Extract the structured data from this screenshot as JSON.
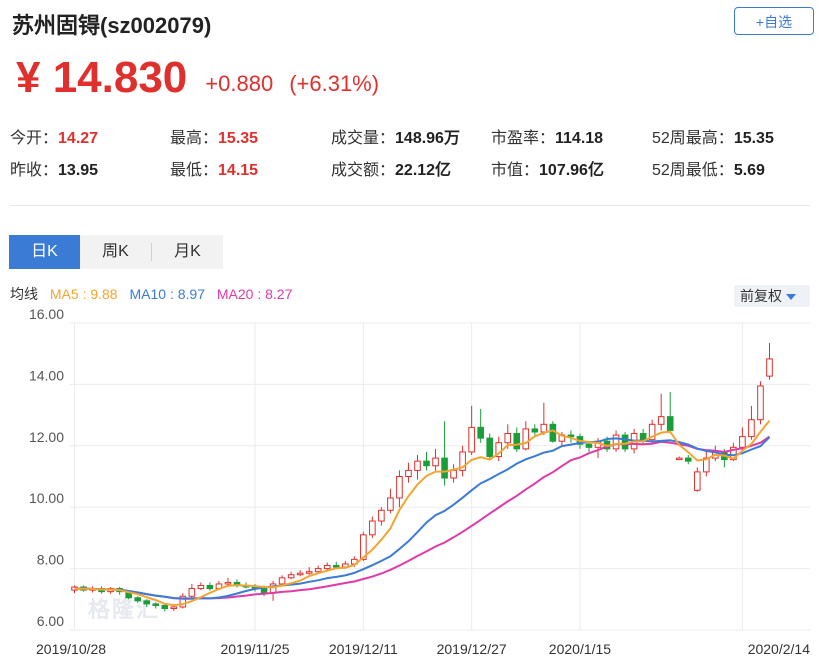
{
  "header": {
    "title": "苏州固锝(sz002079)",
    "add_label": "+自选",
    "price": "¥ 14.830",
    "change": "+0.880",
    "change_pct": "(+6.31%)"
  },
  "stats": [
    {
      "label": "今开：",
      "value": "14.27",
      "color": "red"
    },
    {
      "label": "最高：",
      "value": "15.35",
      "color": "red"
    },
    {
      "label": "成交量：",
      "value": "148.96万",
      "color": "dark"
    },
    {
      "label": "市盈率：",
      "value": "114.18",
      "color": "dark"
    },
    {
      "label": "52周最高：",
      "value": "15.35",
      "color": "dark"
    },
    {
      "label": "昨收：",
      "value": "13.95",
      "color": "dark"
    },
    {
      "label": "最低：",
      "value": "14.15",
      "color": "red"
    },
    {
      "label": "成交额：",
      "value": "22.12亿",
      "color": "dark"
    },
    {
      "label": "市值：",
      "value": "107.96亿",
      "color": "dark"
    },
    {
      "label": "52周最低：",
      "value": "5.69",
      "color": "dark"
    }
  ],
  "tabs": [
    "日K",
    "周K",
    "月K"
  ],
  "active_tab": 0,
  "legend": {
    "label": "均线",
    "ma5": "MA5 : 9.88",
    "ma10": "MA10 : 8.97",
    "ma20": "MA20 : 8.27"
  },
  "adjust_label": "前复权",
  "watermark": "格隆汇",
  "colors": {
    "up": "#e0302d",
    "down": "#1a9e3a",
    "ma5": "#f4a431",
    "ma10": "#3a7bd5",
    "ma20": "#e03aa8",
    "accent": "#3a7bd5"
  },
  "chart_data": {
    "type": "candlestick",
    "ylim": [
      6,
      16
    ],
    "yticks": [
      "16.00",
      "14.00",
      "12.00",
      "10.00",
      "8.00",
      "6.00"
    ],
    "xticks": [
      {
        "index": 0,
        "label": "2019/10/28"
      },
      {
        "index": 20,
        "label": "2019/11/25"
      },
      {
        "index": 32,
        "label": "2019/12/11"
      },
      {
        "index": 44,
        "label": "2019/12/27"
      },
      {
        "index": 56,
        "label": "2020/1/15"
      },
      {
        "index": 74,
        "label": "2020/2/14"
      }
    ],
    "candles": [
      [
        7.3,
        7.4,
        7.45,
        7.2
      ],
      [
        7.4,
        7.3,
        7.45,
        7.25
      ],
      [
        7.3,
        7.35,
        7.42,
        7.22
      ],
      [
        7.35,
        7.25,
        7.42,
        7.18
      ],
      [
        7.25,
        7.35,
        7.4,
        7.18
      ],
      [
        7.35,
        7.25,
        7.4,
        7.15
      ],
      [
        7.25,
        7.05,
        7.3,
        7.0
      ],
      [
        7.05,
        6.95,
        7.1,
        6.88
      ],
      [
        6.95,
        6.85,
        7.0,
        6.75
      ],
      [
        6.85,
        6.8,
        6.9,
        6.7
      ],
      [
        6.8,
        6.7,
        6.85,
        6.6
      ],
      [
        6.7,
        6.75,
        6.82,
        6.62
      ],
      [
        6.75,
        7.1,
        7.2,
        6.7
      ],
      [
        7.1,
        7.35,
        7.5,
        7.05
      ],
      [
        7.35,
        7.45,
        7.55,
        7.3
      ],
      [
        7.45,
        7.35,
        7.55,
        7.28
      ],
      [
        7.35,
        7.5,
        7.6,
        7.3
      ],
      [
        7.5,
        7.55,
        7.7,
        7.4
      ],
      [
        7.55,
        7.45,
        7.65,
        7.38
      ],
      [
        7.45,
        7.4,
        7.55,
        7.35
      ],
      [
        7.4,
        7.35,
        7.5,
        7.25
      ],
      [
        7.35,
        7.2,
        7.45,
        7.1
      ],
      [
        7.2,
        7.5,
        7.6,
        6.95
      ],
      [
        7.5,
        7.7,
        7.78,
        7.45
      ],
      [
        7.7,
        7.8,
        7.9,
        7.65
      ],
      [
        7.8,
        7.85,
        7.95,
        7.75
      ],
      [
        7.85,
        7.9,
        8.05,
        7.8
      ],
      [
        7.9,
        8.0,
        8.1,
        7.85
      ],
      [
        8.0,
        8.1,
        8.2,
        7.95
      ],
      [
        8.1,
        8.05,
        8.22,
        8.0
      ],
      [
        8.05,
        8.15,
        8.25,
        8.0
      ],
      [
        8.15,
        8.3,
        8.4,
        8.05
      ],
      [
        8.3,
        9.1,
        9.2,
        8.25
      ],
      [
        9.1,
        9.55,
        9.7,
        9.0
      ],
      [
        9.55,
        9.9,
        10.0,
        9.4
      ],
      [
        9.9,
        10.3,
        10.6,
        9.8
      ],
      [
        10.3,
        11.0,
        11.2,
        10.0
      ],
      [
        11.0,
        11.2,
        11.45,
        10.8
      ],
      [
        11.2,
        11.5,
        11.7,
        10.9
      ],
      [
        11.5,
        11.35,
        11.8,
        11.2
      ],
      [
        11.35,
        11.6,
        11.9,
        11.2
      ],
      [
        11.6,
        10.95,
        12.8,
        10.7
      ],
      [
        10.95,
        11.2,
        11.4,
        10.8
      ],
      [
        11.2,
        11.8,
        12.0,
        11.0
      ],
      [
        11.8,
        12.6,
        13.3,
        11.7
      ],
      [
        12.6,
        12.25,
        13.2,
        12.1
      ],
      [
        12.25,
        11.65,
        12.4,
        11.55
      ],
      [
        11.65,
        12.1,
        12.3,
        11.5
      ],
      [
        12.1,
        12.4,
        12.7,
        11.9
      ],
      [
        12.4,
        11.9,
        12.6,
        11.8
      ],
      [
        11.9,
        12.55,
        12.8,
        11.85
      ],
      [
        12.55,
        12.45,
        12.7,
        12.3
      ],
      [
        12.45,
        12.7,
        13.4,
        12.35
      ],
      [
        12.7,
        12.15,
        12.8,
        12.1
      ],
      [
        12.15,
        12.35,
        12.45,
        12.0
      ],
      [
        12.35,
        12.3,
        12.5,
        12.1
      ],
      [
        12.3,
        12.05,
        12.4,
        11.9
      ],
      [
        12.05,
        11.95,
        12.15,
        11.8
      ],
      [
        11.95,
        12.15,
        12.25,
        11.6
      ],
      [
        12.15,
        11.9,
        12.3,
        11.8
      ],
      [
        11.9,
        12.35,
        12.5,
        11.8
      ],
      [
        12.35,
        11.9,
        12.45,
        11.8
      ],
      [
        11.9,
        12.4,
        12.55,
        11.75
      ],
      [
        12.4,
        12.2,
        12.55,
        12.05
      ],
      [
        12.2,
        12.7,
        12.85,
        12.1
      ],
      [
        12.7,
        12.95,
        13.7,
        12.5
      ],
      [
        12.95,
        12.5,
        13.75,
        12.4
      ],
      [
        11.6,
        11.6,
        11.65,
        11.55
      ],
      [
        11.6,
        11.5,
        11.7,
        11.4
      ],
      [
        10.55,
        11.15,
        11.3,
        10.5
      ],
      [
        11.15,
        11.6,
        11.85,
        11.0
      ],
      [
        11.6,
        11.8,
        12.0,
        11.5
      ],
      [
        11.8,
        11.55,
        11.9,
        11.3
      ],
      [
        11.55,
        11.95,
        12.1,
        11.5
      ],
      [
        11.95,
        12.3,
        12.6,
        11.85
      ],
      [
        12.3,
        12.85,
        13.3,
        12.2
      ],
      [
        12.85,
        13.95,
        14.1,
        12.7
      ],
      [
        14.27,
        14.83,
        15.35,
        14.15
      ]
    ],
    "ma5": [
      7.34,
      7.35,
      7.34,
      7.32,
      7.32,
      7.3,
      7.23,
      7.17,
      7.07,
      6.98,
      6.85,
      6.81,
      6.84,
      6.94,
      7.07,
      7.21,
      7.34,
      7.44,
      7.46,
      7.45,
      7.43,
      7.4,
      7.39,
      7.45,
      7.52,
      7.61,
      7.76,
      7.85,
      7.93,
      8.01,
      8.03,
      8.12,
      8.36,
      8.62,
      8.94,
      9.31,
      9.91,
      10.36,
      10.74,
      11.02,
      11.16,
      11.16,
      11.22,
      11.3,
      11.54,
      11.63,
      11.55,
      11.75,
      12.02,
      12.04,
      12.09,
      12.31,
      12.42,
      12.5,
      12.33,
      12.26,
      12.16,
      12.12,
      12.09,
      12.0,
      12.06,
      12.07,
      12.14,
      12.15,
      12.3,
      12.43,
      12.46,
      12.03,
      11.79,
      11.52,
      11.56,
      11.71,
      11.68,
      11.58,
      11.84,
      12.06,
      12.46,
      12.82
    ],
    "ma10": [
      7.34,
      7.35,
      7.34,
      7.33,
      7.32,
      7.31,
      7.27,
      7.22,
      7.17,
      7.12,
      7.08,
      7.04,
      7.03,
      7.03,
      7.04,
      7.03,
      7.06,
      7.11,
      7.19,
      7.27,
      7.34,
      7.38,
      7.42,
      7.45,
      7.48,
      7.51,
      7.57,
      7.62,
      7.69,
      7.73,
      7.78,
      7.86,
      7.98,
      8.11,
      8.25,
      8.4,
      8.64,
      8.89,
      9.19,
      9.5,
      9.74,
      9.88,
      10.08,
      10.31,
      10.55,
      10.78,
      10.92,
      11.08,
      11.23,
      11.42,
      11.56,
      11.66,
      11.78,
      11.84,
      11.99,
      12.04,
      12.09,
      12.12,
      12.13,
      12.22,
      12.24,
      12.21,
      12.17,
      12.17,
      12.14,
      12.16,
      12.18,
      12.12,
      12.04,
      11.91,
      11.83,
      11.79,
      11.71,
      11.69,
      11.76,
      11.88,
      11.99,
      12.28
    ],
    "ma20": [
      7.34,
      7.35,
      7.34,
      7.33,
      7.32,
      7.31,
      7.27,
      7.22,
      7.17,
      7.12,
      7.08,
      7.04,
      7.02,
      7.02,
      7.03,
      7.03,
      7.04,
      7.06,
      7.09,
      7.12,
      7.16,
      7.18,
      7.21,
      7.24,
      7.26,
      7.3,
      7.33,
      7.37,
      7.42,
      7.48,
      7.53,
      7.58,
      7.66,
      7.74,
      7.84,
      7.96,
      8.1,
      8.25,
      8.41,
      8.56,
      8.72,
      8.85,
      9.02,
      9.2,
      9.39,
      9.59,
      9.79,
      9.99,
      10.19,
      10.37,
      10.58,
      10.77,
      10.98,
      11.14,
      11.34,
      11.53,
      11.62,
      11.76,
      11.86,
      11.98,
      12.05,
      12.06,
      12.06,
      12.05,
      12.07,
      12.13,
      12.1,
      12.05,
      12.0,
      11.9,
      11.86,
      11.84,
      11.8,
      11.87,
      11.92,
      12.0,
      12.1,
      12.3
    ]
  }
}
